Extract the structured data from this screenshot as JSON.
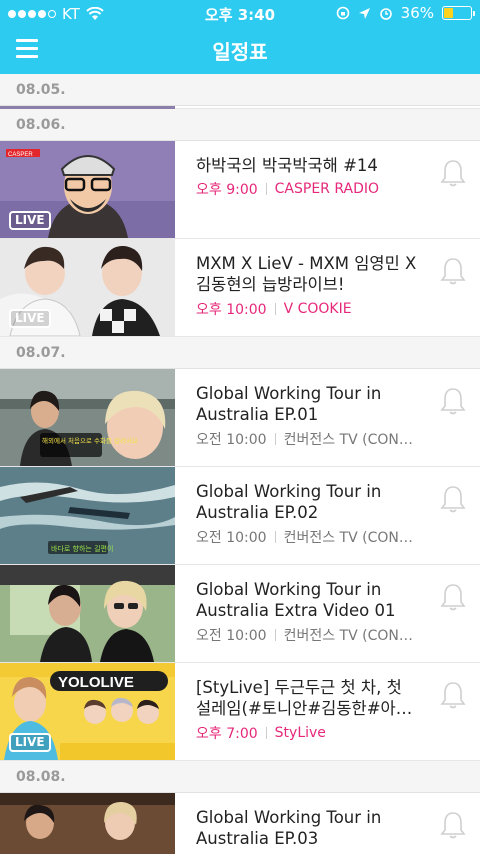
{
  "status_bar": {
    "carrier": "KT",
    "time": "오후 3:40",
    "battery": "36%",
    "battery_level": 0.36
  },
  "header": {
    "title": "일정표"
  },
  "sections": [
    {
      "date": "08.05."
    },
    {
      "date": "08.06.",
      "items": [
        {
          "title": "하박국의 박국박국해 #14",
          "time": "오후 9:00",
          "channel": "CASPER RADIO",
          "live_badge": "LIVE",
          "thumb_text": "CASPER"
        },
        {
          "title": "MXM X LieV - MXM 임영민 X 김동현의 늡방라이브!",
          "time": "오후 10:00",
          "channel": "V COOKIE",
          "live_badge": "LIVE"
        }
      ]
    },
    {
      "date": "08.07.",
      "items": [
        {
          "title": "Global Working Tour in Australia EP.01",
          "time": "오전 10:00",
          "channel": "컨버전스 TV (CON…",
          "thumb_caption": "해외에서 처음으로 수화를 걸려서요"
        },
        {
          "title": "Global Working Tour in Australia EP.02",
          "time": "오전 10:00",
          "channel": "컨버전스 TV (CON…",
          "thumb_caption": "바다로 향하는 길편이"
        },
        {
          "title": "Global Working Tour in Australia Extra Video 01",
          "time": "오전 10:00",
          "channel": "컨버전스 TV (CON…"
        },
        {
          "title": "[StyLive] 두근두근 첫 차, 첫 설레임(#토니안#김동한#아…",
          "time": "오후 7:00",
          "channel": "StyLive",
          "live_badge": "LIVE",
          "thumb_text": "YOLOLIVE"
        }
      ]
    },
    {
      "date": "08.08.",
      "items": [
        {
          "title": "Global Working Tour in Australia EP.03"
        }
      ]
    }
  ],
  "colors": {
    "accent": "#2ecbf0",
    "pink": "#e6287a",
    "header_bg": "#f5f5f5"
  }
}
